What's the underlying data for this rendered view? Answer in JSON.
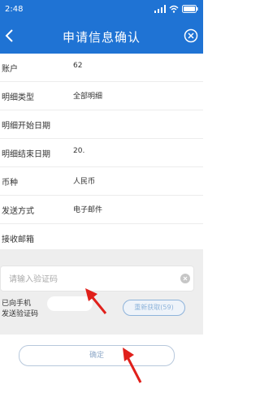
{
  "status_bar": {
    "time": "2:48",
    "icons": [
      "location-icon",
      "signal-icon",
      "wifi-icon",
      "battery-icon"
    ]
  },
  "header": {
    "title": "申请信息确认",
    "back_icon": "back-chevron-icon",
    "close_icon": "close-circle-icon"
  },
  "rows": [
    {
      "label": "账户",
      "value": "62"
    },
    {
      "label": "明细类型",
      "value": "全部明细"
    },
    {
      "label": "明细开始日期",
      "value": ""
    },
    {
      "label": "明细结束日期",
      "value": "20."
    },
    {
      "label": "币种",
      "value": "人民币"
    },
    {
      "label": "发送方式",
      "value": "电子邮件"
    },
    {
      "label": "接收邮箱",
      "value": ""
    }
  ],
  "verification": {
    "placeholder": "请输入验证码",
    "value": "",
    "sent_line1": "已向手机",
    "sent_line2": "发送验证码",
    "resend_label": "重新获取(59)"
  },
  "confirm_label": "确定",
  "colors": {
    "brand": "#1f73d4",
    "arrow": "#e0201b",
    "gray_bg": "#eeeeee",
    "disabled_blue": "#8fb4db"
  }
}
